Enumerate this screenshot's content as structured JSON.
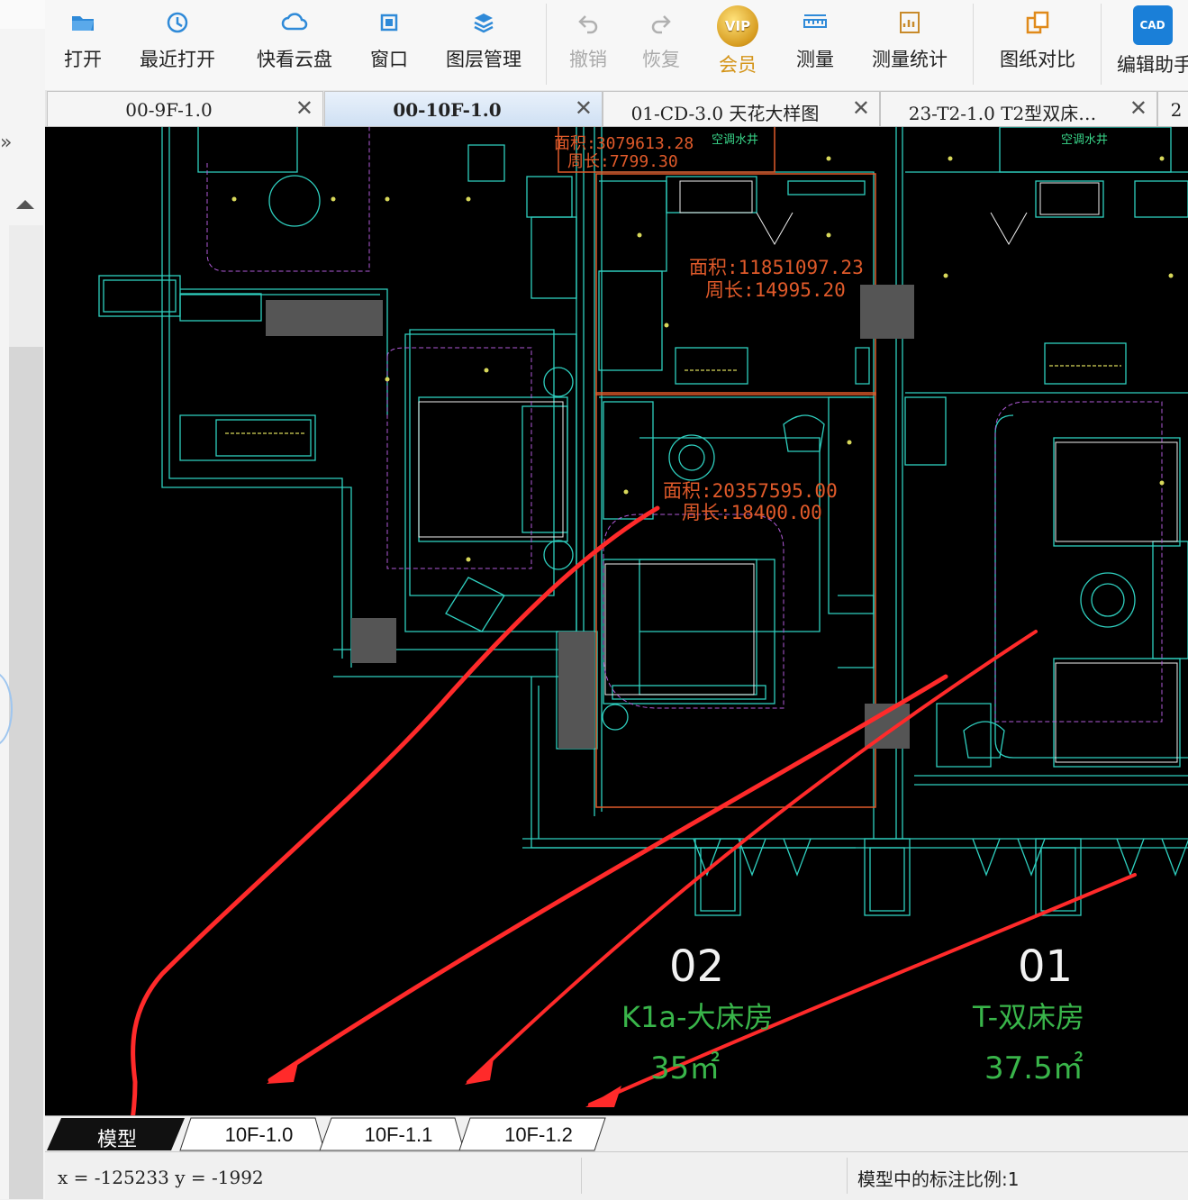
{
  "toolbar": {
    "open": "打开",
    "recent": "最近打开",
    "cloud": "快看云盘",
    "window": "窗口",
    "layers": "图层管理",
    "undo": "撤销",
    "redo": "恢复",
    "vip_badge": "VIP",
    "vip": "会员",
    "measure": "测量",
    "measure_stats": "测量统计",
    "compare": "图纸对比",
    "edit_assistant": "编辑助手",
    "cad_badge": "CAD"
  },
  "left_strip": {
    "expand_glyph": "»"
  },
  "tabs": [
    {
      "label": "00-9F-1.0",
      "close": "✕"
    },
    {
      "label": "00-10F-1.0",
      "close": "✕"
    },
    {
      "label": "01-CD-3.0 天花大样图",
      "close": "✕"
    },
    {
      "label": "23-T2-1.0 T2型双床…",
      "close": "✕"
    },
    {
      "label": "2"
    }
  ],
  "drawing": {
    "annot1_area": "面积:3079613.28",
    "annot1_perim": "周长:7799.30",
    "annot2_area": "面积:11851097.23",
    "annot2_perim": "周长:14995.20",
    "annot3_area": "面积:20357595.00",
    "annot3_perim": "周长:18400.00",
    "ac_label_1": "空调水井",
    "ac_label_2": "空调水井",
    "room1_number": "02",
    "room1_name": "K1a-大床房",
    "room1_area": "35㎡",
    "room2_number": "01",
    "room2_name": "T-双床房",
    "room2_area": "37.5㎡",
    "colors": {
      "background": "#000000",
      "walls": "#2fd0c0",
      "annotation": "#e05a2a",
      "room_text": "#39b54a",
      "room_number": "#ffffff",
      "arrows": "#ff2a2a"
    }
  },
  "layout_tabs": [
    "模型",
    "10F-1.0",
    "10F-1.1",
    "10F-1.2"
  ],
  "status": {
    "coords": "x = -125233  y = -1992",
    "scale": "模型中的标注比例:1"
  }
}
